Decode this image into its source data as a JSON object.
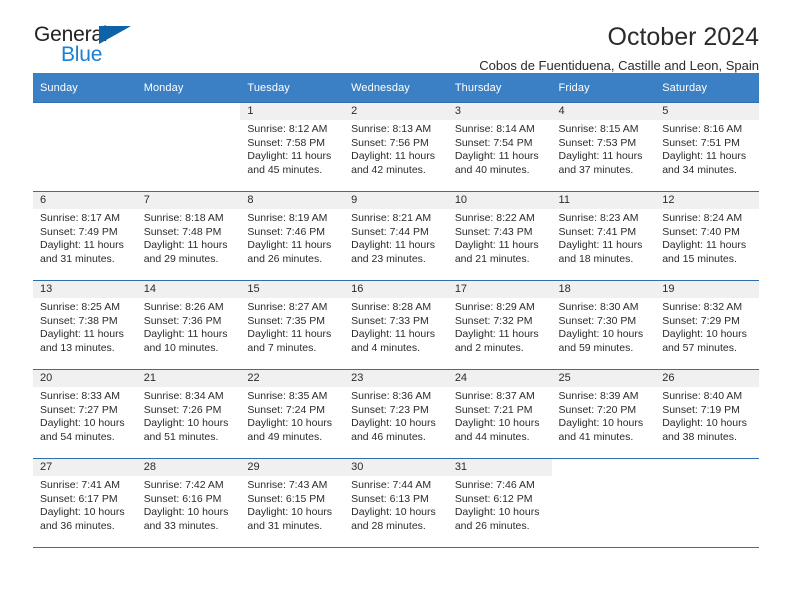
{
  "brand": {
    "name_top": "General",
    "name_bottom": "Blue",
    "accent_color": "#1b7fd4",
    "triangle_color": "#0d62a8"
  },
  "header": {
    "title": "October 2024",
    "subtitle": "Cobos de Fuentiduena, Castille and Leon, Spain",
    "header_bar_color": "#3b7fc4",
    "row_border_color": "#2f6fb0",
    "daynum_band_color": "#f0f0f0"
  },
  "weekdays": [
    "Sunday",
    "Monday",
    "Tuesday",
    "Wednesday",
    "Thursday",
    "Friday",
    "Saturday"
  ],
  "weeks": [
    [
      {
        "day": "",
        "sunrise": "",
        "sunset": "",
        "daylight": "",
        "empty": true
      },
      {
        "day": "",
        "sunrise": "",
        "sunset": "",
        "daylight": "",
        "empty": true
      },
      {
        "day": "1",
        "sunrise": "Sunrise: 8:12 AM",
        "sunset": "Sunset: 7:58 PM",
        "daylight": "Daylight: 11 hours and 45 minutes.",
        "empty": false
      },
      {
        "day": "2",
        "sunrise": "Sunrise: 8:13 AM",
        "sunset": "Sunset: 7:56 PM",
        "daylight": "Daylight: 11 hours and 42 minutes.",
        "empty": false
      },
      {
        "day": "3",
        "sunrise": "Sunrise: 8:14 AM",
        "sunset": "Sunset: 7:54 PM",
        "daylight": "Daylight: 11 hours and 40 minutes.",
        "empty": false
      },
      {
        "day": "4",
        "sunrise": "Sunrise: 8:15 AM",
        "sunset": "Sunset: 7:53 PM",
        "daylight": "Daylight: 11 hours and 37 minutes.",
        "empty": false
      },
      {
        "day": "5",
        "sunrise": "Sunrise: 8:16 AM",
        "sunset": "Sunset: 7:51 PM",
        "daylight": "Daylight: 11 hours and 34 minutes.",
        "empty": false
      }
    ],
    [
      {
        "day": "6",
        "sunrise": "Sunrise: 8:17 AM",
        "sunset": "Sunset: 7:49 PM",
        "daylight": "Daylight: 11 hours and 31 minutes.",
        "empty": false
      },
      {
        "day": "7",
        "sunrise": "Sunrise: 8:18 AM",
        "sunset": "Sunset: 7:48 PM",
        "daylight": "Daylight: 11 hours and 29 minutes.",
        "empty": false
      },
      {
        "day": "8",
        "sunrise": "Sunrise: 8:19 AM",
        "sunset": "Sunset: 7:46 PM",
        "daylight": "Daylight: 11 hours and 26 minutes.",
        "empty": false
      },
      {
        "day": "9",
        "sunrise": "Sunrise: 8:21 AM",
        "sunset": "Sunset: 7:44 PM",
        "daylight": "Daylight: 11 hours and 23 minutes.",
        "empty": false
      },
      {
        "day": "10",
        "sunrise": "Sunrise: 8:22 AM",
        "sunset": "Sunset: 7:43 PM",
        "daylight": "Daylight: 11 hours and 21 minutes.",
        "empty": false
      },
      {
        "day": "11",
        "sunrise": "Sunrise: 8:23 AM",
        "sunset": "Sunset: 7:41 PM",
        "daylight": "Daylight: 11 hours and 18 minutes.",
        "empty": false
      },
      {
        "day": "12",
        "sunrise": "Sunrise: 8:24 AM",
        "sunset": "Sunset: 7:40 PM",
        "daylight": "Daylight: 11 hours and 15 minutes.",
        "empty": false
      }
    ],
    [
      {
        "day": "13",
        "sunrise": "Sunrise: 8:25 AM",
        "sunset": "Sunset: 7:38 PM",
        "daylight": "Daylight: 11 hours and 13 minutes.",
        "empty": false
      },
      {
        "day": "14",
        "sunrise": "Sunrise: 8:26 AM",
        "sunset": "Sunset: 7:36 PM",
        "daylight": "Daylight: 11 hours and 10 minutes.",
        "empty": false
      },
      {
        "day": "15",
        "sunrise": "Sunrise: 8:27 AM",
        "sunset": "Sunset: 7:35 PM",
        "daylight": "Daylight: 11 hours and 7 minutes.",
        "empty": false
      },
      {
        "day": "16",
        "sunrise": "Sunrise: 8:28 AM",
        "sunset": "Sunset: 7:33 PM",
        "daylight": "Daylight: 11 hours and 4 minutes.",
        "empty": false
      },
      {
        "day": "17",
        "sunrise": "Sunrise: 8:29 AM",
        "sunset": "Sunset: 7:32 PM",
        "daylight": "Daylight: 11 hours and 2 minutes.",
        "empty": false
      },
      {
        "day": "18",
        "sunrise": "Sunrise: 8:30 AM",
        "sunset": "Sunset: 7:30 PM",
        "daylight": "Daylight: 10 hours and 59 minutes.",
        "empty": false
      },
      {
        "day": "19",
        "sunrise": "Sunrise: 8:32 AM",
        "sunset": "Sunset: 7:29 PM",
        "daylight": "Daylight: 10 hours and 57 minutes.",
        "empty": false
      }
    ],
    [
      {
        "day": "20",
        "sunrise": "Sunrise: 8:33 AM",
        "sunset": "Sunset: 7:27 PM",
        "daylight": "Daylight: 10 hours and 54 minutes.",
        "empty": false
      },
      {
        "day": "21",
        "sunrise": "Sunrise: 8:34 AM",
        "sunset": "Sunset: 7:26 PM",
        "daylight": "Daylight: 10 hours and 51 minutes.",
        "empty": false
      },
      {
        "day": "22",
        "sunrise": "Sunrise: 8:35 AM",
        "sunset": "Sunset: 7:24 PM",
        "daylight": "Daylight: 10 hours and 49 minutes.",
        "empty": false
      },
      {
        "day": "23",
        "sunrise": "Sunrise: 8:36 AM",
        "sunset": "Sunset: 7:23 PM",
        "daylight": "Daylight: 10 hours and 46 minutes.",
        "empty": false
      },
      {
        "day": "24",
        "sunrise": "Sunrise: 8:37 AM",
        "sunset": "Sunset: 7:21 PM",
        "daylight": "Daylight: 10 hours and 44 minutes.",
        "empty": false
      },
      {
        "day": "25",
        "sunrise": "Sunrise: 8:39 AM",
        "sunset": "Sunset: 7:20 PM",
        "daylight": "Daylight: 10 hours and 41 minutes.",
        "empty": false
      },
      {
        "day": "26",
        "sunrise": "Sunrise: 8:40 AM",
        "sunset": "Sunset: 7:19 PM",
        "daylight": "Daylight: 10 hours and 38 minutes.",
        "empty": false
      }
    ],
    [
      {
        "day": "27",
        "sunrise": "Sunrise: 7:41 AM",
        "sunset": "Sunset: 6:17 PM",
        "daylight": "Daylight: 10 hours and 36 minutes.",
        "empty": false
      },
      {
        "day": "28",
        "sunrise": "Sunrise: 7:42 AM",
        "sunset": "Sunset: 6:16 PM",
        "daylight": "Daylight: 10 hours and 33 minutes.",
        "empty": false
      },
      {
        "day": "29",
        "sunrise": "Sunrise: 7:43 AM",
        "sunset": "Sunset: 6:15 PM",
        "daylight": "Daylight: 10 hours and 31 minutes.",
        "empty": false
      },
      {
        "day": "30",
        "sunrise": "Sunrise: 7:44 AM",
        "sunset": "Sunset: 6:13 PM",
        "daylight": "Daylight: 10 hours and 28 minutes.",
        "empty": false
      },
      {
        "day": "31",
        "sunrise": "Sunrise: 7:46 AM",
        "sunset": "Sunset: 6:12 PM",
        "daylight": "Daylight: 10 hours and 26 minutes.",
        "empty": false
      },
      {
        "day": "",
        "sunrise": "",
        "sunset": "",
        "daylight": "",
        "empty": true
      },
      {
        "day": "",
        "sunrise": "",
        "sunset": "",
        "daylight": "",
        "empty": true
      }
    ]
  ]
}
